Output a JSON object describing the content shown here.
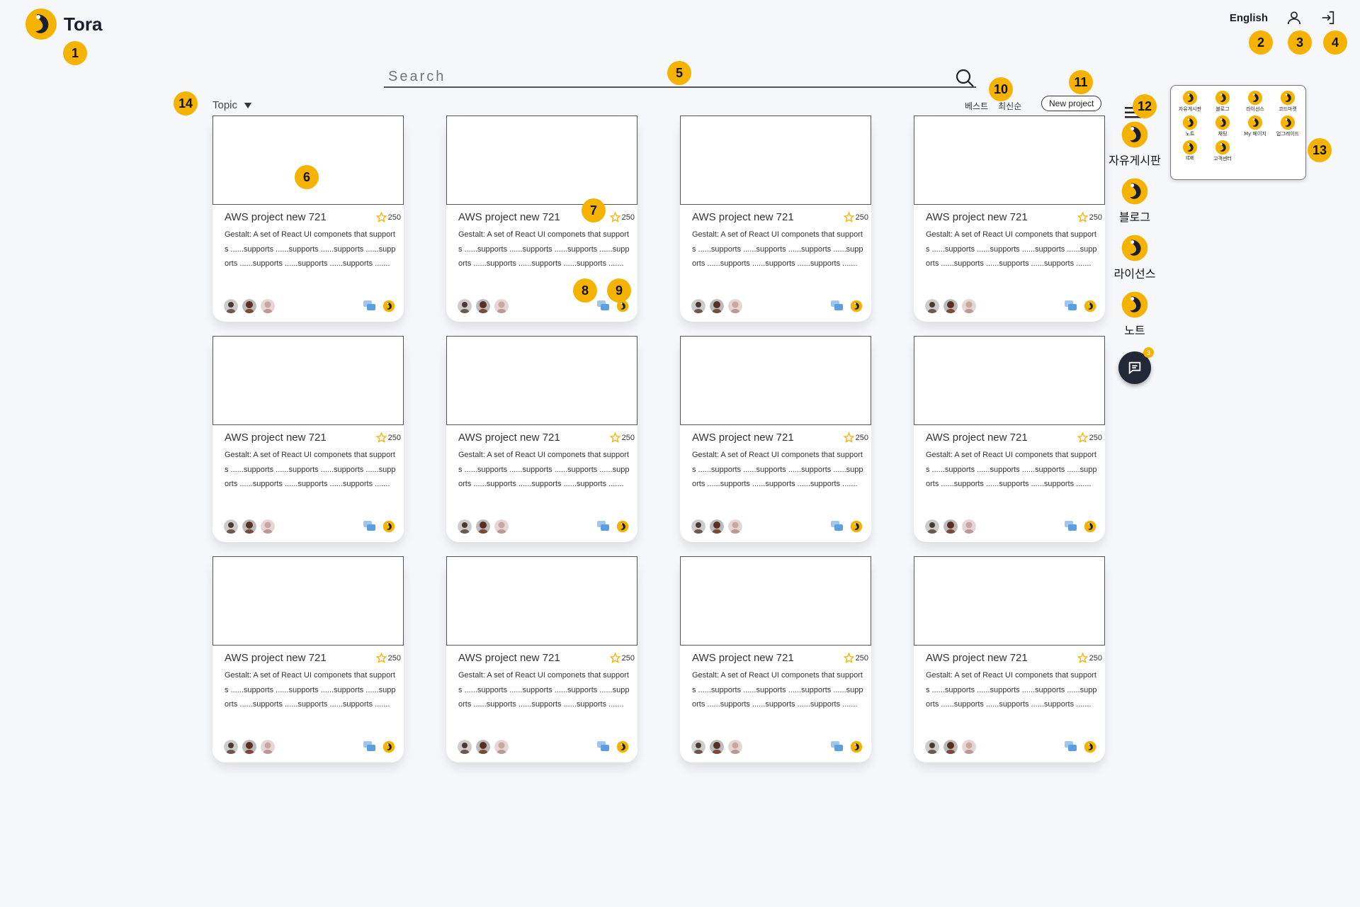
{
  "brand": {
    "name": "Tora"
  },
  "header": {
    "language": "English",
    "icons": [
      "user-icon",
      "login-icon"
    ]
  },
  "search": {
    "placeholder": "Search",
    "value": ""
  },
  "filters": {
    "topic": "Topic",
    "sort_best": "베스트",
    "sort_latest": "최신순",
    "new_project": "New project"
  },
  "cards": [
    {
      "title": "AWS project new 721",
      "stars": "250",
      "desc": "Gestalt: A set of React UI componets that supports ......supports ......supports ......supports ......supports ......supports ......supports ......supports ......."
    },
    {
      "title": "AWS project new 721",
      "stars": "250",
      "desc": "Gestalt: A set of React UI componets that supports ......supports ......supports ......supports ......supports ......supports ......supports ......supports ......."
    },
    {
      "title": "AWS project new 721",
      "stars": "250",
      "desc": "Gestalt: A set of React UI componets that supports ......supports ......supports ......supports ......supports ......supports ......supports ......supports ......."
    },
    {
      "title": "AWS project new 721",
      "stars": "250",
      "desc": "Gestalt: A set of React UI componets that supports ......supports ......supports ......supports ......supports ......supports ......supports ......supports ......."
    },
    {
      "title": "AWS project new 721",
      "stars": "250",
      "desc": "Gestalt: A set of React UI componets that supports ......supports ......supports ......supports ......supports ......supports ......supports ......supports ......."
    },
    {
      "title": "AWS project new 721",
      "stars": "250",
      "desc": "Gestalt: A set of React UI componets that supports ......supports ......supports ......supports ......supports ......supports ......supports ......supports ......."
    },
    {
      "title": "AWS project new 721",
      "stars": "250",
      "desc": "Gestalt: A set of React UI componets that supports ......supports ......supports ......supports ......supports ......supports ......supports ......supports ......."
    },
    {
      "title": "AWS project new 721",
      "stars": "250",
      "desc": "Gestalt: A set of React UI componets that supports ......supports ......supports ......supports ......supports ......supports ......supports ......supports ......."
    },
    {
      "title": "AWS project new 721",
      "stars": "250",
      "desc": "Gestalt: A set of React UI componets that supports ......supports ......supports ......supports ......supports ......supports ......supports ......supports ......."
    },
    {
      "title": "AWS project new 721",
      "stars": "250",
      "desc": "Gestalt: A set of React UI componets that supports ......supports ......supports ......supports ......supports ......supports ......supports ......supports ......."
    },
    {
      "title": "AWS project new 721",
      "stars": "250",
      "desc": "Gestalt: A set of React UI componets that supports ......supports ......supports ......supports ......supports ......supports ......supports ......supports ......."
    },
    {
      "title": "AWS project new 721",
      "stars": "250",
      "desc": "Gestalt: A set of React UI componets that supports ......supports ......supports ......supports ......supports ......supports ......supports ......supports ......."
    }
  ],
  "sidebar": {
    "items": [
      {
        "label": "자유게시판"
      },
      {
        "label": "블로그"
      },
      {
        "label": "라이선스"
      },
      {
        "label": "노트"
      }
    ],
    "chat_badge": "3"
  },
  "popup_menu": {
    "items": [
      {
        "label": "자유게시판"
      },
      {
        "label": "블로그"
      },
      {
        "label": "라이선스"
      },
      {
        "label": "코드마켓"
      },
      {
        "label": "노트"
      },
      {
        "label": "채팅"
      },
      {
        "label": "My 페이지"
      },
      {
        "label": "업그레이드"
      },
      {
        "label": "IDE"
      },
      {
        "label": "고객센터"
      }
    ]
  },
  "annotations": [
    "1",
    "2",
    "3",
    "4",
    "5",
    "6",
    "7",
    "8",
    "9",
    "10",
    "11",
    "12",
    "13",
    "14"
  ],
  "colors": {
    "accent": "#f5b300",
    "dark": "#1b1f2c",
    "background": "#f6f7fb"
  }
}
